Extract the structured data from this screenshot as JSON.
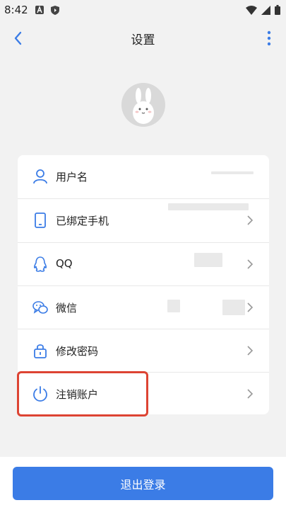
{
  "status_bar": {
    "time": "8:42"
  },
  "header": {
    "title": "设置"
  },
  "settings": {
    "items": [
      {
        "label": "用户名"
      },
      {
        "label": "已绑定手机"
      },
      {
        "label": "QQ"
      },
      {
        "label": "微信"
      },
      {
        "label": "修改密码"
      },
      {
        "label": "注销账户"
      }
    ]
  },
  "logout_button": {
    "label": "退出登录"
  },
  "colors": {
    "accent": "#3b7ce6",
    "highlight": "#dd4433",
    "background": "#f2f2f2"
  }
}
